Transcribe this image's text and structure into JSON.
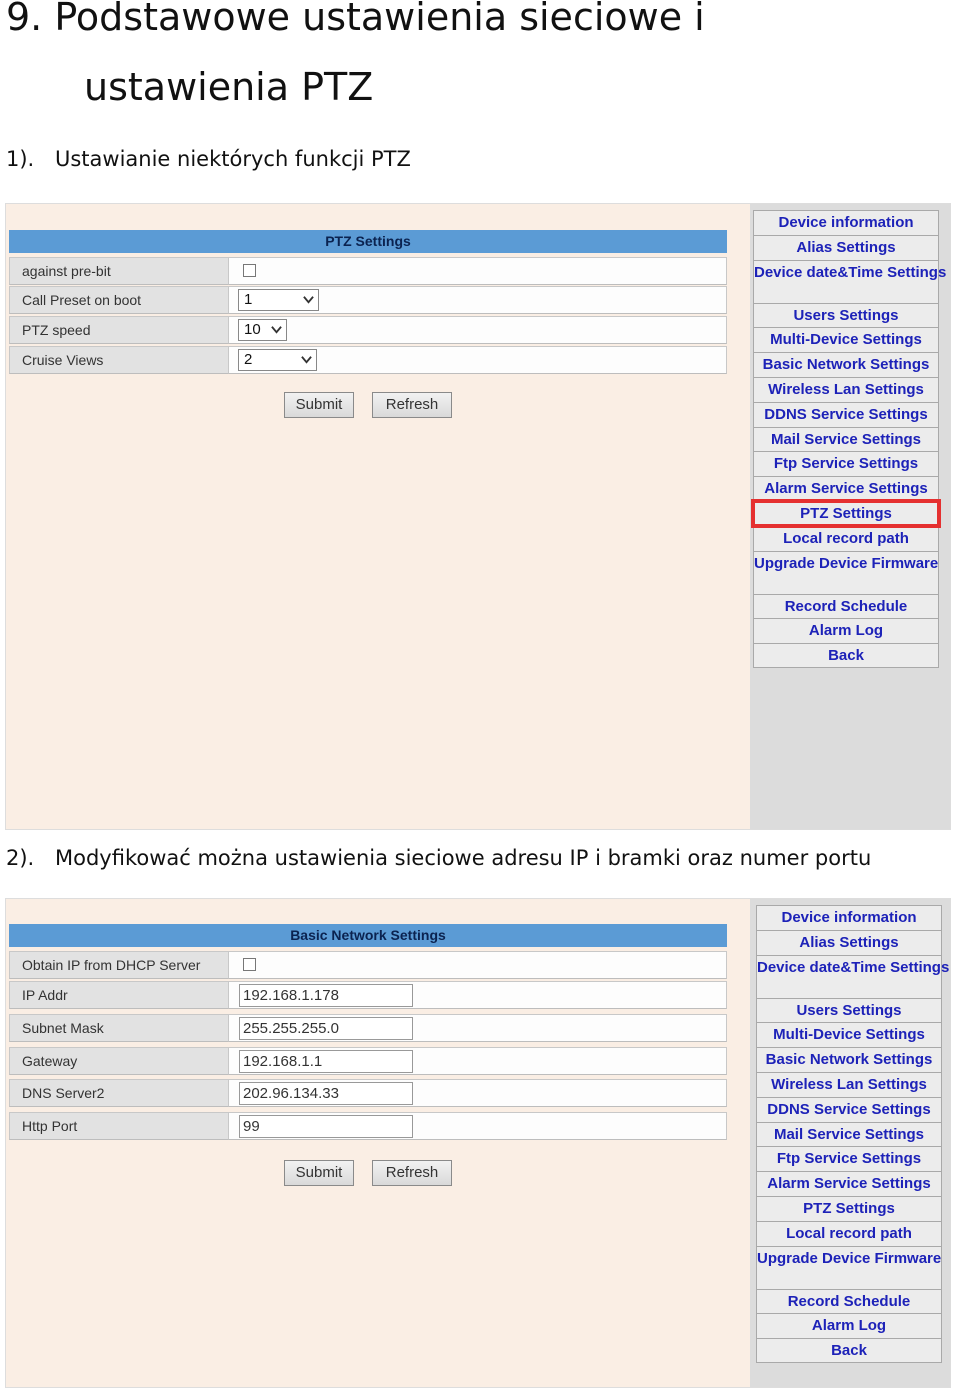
{
  "doc": {
    "title_line1": "9. Podstawowe ustawienia sieciowe i",
    "title_line2": "ustawienia PTZ",
    "step1_num": "1).",
    "step1_text": "Ustawianie niektórych funkcji PTZ",
    "step2_num": "2).",
    "step2_text": "Modyfikować można ustawienia sieciowe adresu IP i bramki oraz numer portu"
  },
  "ptz": {
    "title": "PTZ Settings",
    "rows": [
      {
        "label": "against pre-bit"
      },
      {
        "label": "Call Preset on boot",
        "value": "1"
      },
      {
        "label": "PTZ speed",
        "value": "10"
      },
      {
        "label": "Cruise Views",
        "value": "2"
      }
    ],
    "submit": "Submit",
    "refresh": "Refresh"
  },
  "network": {
    "title": "Basic Network Settings",
    "rows": [
      {
        "label": "Obtain IP from DHCP Server"
      },
      {
        "label": "IP Addr",
        "value": "192.168.1.178"
      },
      {
        "label": "Subnet Mask",
        "value": "255.255.255.0"
      },
      {
        "label": "Gateway",
        "value": "192.168.1.1"
      },
      {
        "label": "DNS Server2",
        "value": "202.96.134.33"
      },
      {
        "label": "Http Port",
        "value": "99"
      }
    ],
    "submit": "Submit",
    "refresh": "Refresh"
  },
  "menu": {
    "items": [
      "Device information",
      "Alias Settings",
      "Device date&Time Settings",
      "Users Settings",
      "Multi-Device Settings",
      "Basic Network Settings",
      "Wireless Lan Settings",
      "DDNS Service Settings",
      "Mail Service Settings",
      "Ftp Service Settings",
      "Alarm Service Settings",
      "PTZ Settings",
      "Local record path",
      "Upgrade Device Firmware",
      "Record Schedule",
      "Alarm Log",
      "Back"
    ],
    "highlighted": "PTZ Settings",
    "highlight_color": "#e53030",
    "link_color": "#1d22b8",
    "header_color": "#5b9bd5"
  }
}
